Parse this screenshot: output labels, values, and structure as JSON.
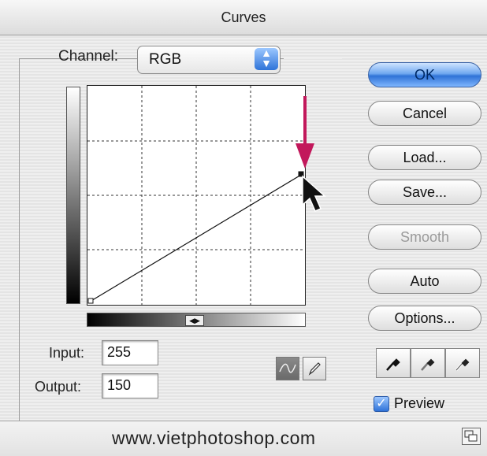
{
  "window": {
    "title": "Curves"
  },
  "channel": {
    "label": "Channel:",
    "value": "RGB"
  },
  "curve": {
    "input_label": "Input:",
    "input_value": "255",
    "output_label": "Output:",
    "output_value": "150"
  },
  "buttons": {
    "ok": "OK",
    "cancel": "Cancel",
    "load": "Load...",
    "save": "Save...",
    "smooth": "Smooth",
    "auto": "Auto",
    "options": "Options..."
  },
  "preview": {
    "label": "Preview",
    "checked": true
  },
  "footer": {
    "watermark": "www.vietphotoshop.com"
  },
  "colors": {
    "arrow": "#c2185b",
    "ok_button": "#4a8ae0"
  },
  "icons": [
    "chevron-updown-icon",
    "curve-tool-icon",
    "pencil-tool-icon",
    "eyedropper-icon",
    "slider-knob-icon",
    "arrow-cursor-icon",
    "resize-icon"
  ]
}
